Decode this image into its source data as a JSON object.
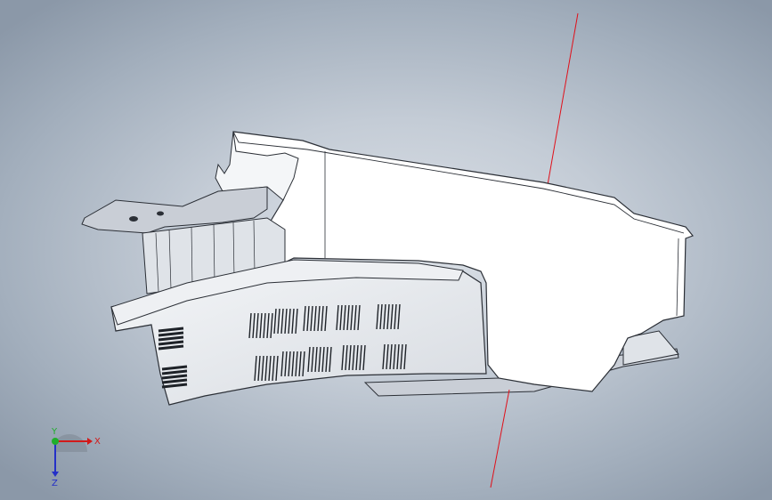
{
  "viewport": {
    "background_top": "#dde2e8",
    "background_edge": "#8b98a8"
  },
  "model": {
    "body_fill": "#ffffff",
    "edge_color": "#2b2f36",
    "shade_color": "#c9ced6",
    "vent_color": "#1e2228",
    "axis_line_color": "#e0101a"
  },
  "triad": {
    "x_label": "X",
    "y_label": "Y",
    "z_label": "Z",
    "x_color": "#d21a1a",
    "y_color": "#1fae2b",
    "z_color": "#2430c8"
  }
}
